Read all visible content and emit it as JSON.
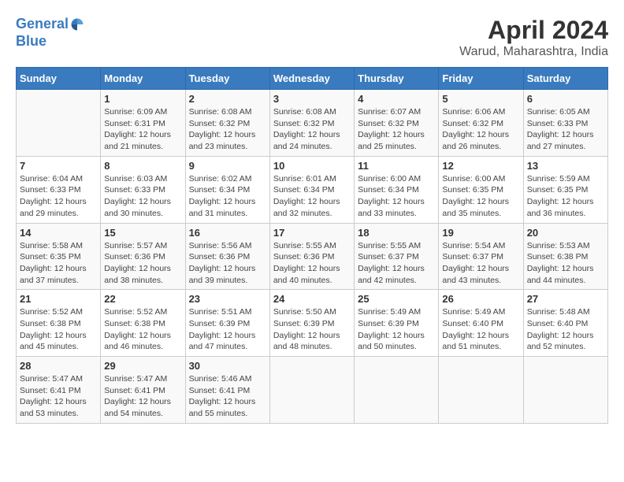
{
  "header": {
    "logo_line1": "General",
    "logo_line2": "Blue",
    "title": "April 2024",
    "subtitle": "Warud, Maharashtra, India"
  },
  "columns": [
    "Sunday",
    "Monday",
    "Tuesday",
    "Wednesday",
    "Thursday",
    "Friday",
    "Saturday"
  ],
  "weeks": [
    [
      {
        "date": "",
        "info": ""
      },
      {
        "date": "1",
        "info": "Sunrise: 6:09 AM\nSunset: 6:31 PM\nDaylight: 12 hours\nand 21 minutes."
      },
      {
        "date": "2",
        "info": "Sunrise: 6:08 AM\nSunset: 6:32 PM\nDaylight: 12 hours\nand 23 minutes."
      },
      {
        "date": "3",
        "info": "Sunrise: 6:08 AM\nSunset: 6:32 PM\nDaylight: 12 hours\nand 24 minutes."
      },
      {
        "date": "4",
        "info": "Sunrise: 6:07 AM\nSunset: 6:32 PM\nDaylight: 12 hours\nand 25 minutes."
      },
      {
        "date": "5",
        "info": "Sunrise: 6:06 AM\nSunset: 6:32 PM\nDaylight: 12 hours\nand 26 minutes."
      },
      {
        "date": "6",
        "info": "Sunrise: 6:05 AM\nSunset: 6:33 PM\nDaylight: 12 hours\nand 27 minutes."
      }
    ],
    [
      {
        "date": "7",
        "info": "Sunrise: 6:04 AM\nSunset: 6:33 PM\nDaylight: 12 hours\nand 29 minutes."
      },
      {
        "date": "8",
        "info": "Sunrise: 6:03 AM\nSunset: 6:33 PM\nDaylight: 12 hours\nand 30 minutes."
      },
      {
        "date": "9",
        "info": "Sunrise: 6:02 AM\nSunset: 6:34 PM\nDaylight: 12 hours\nand 31 minutes."
      },
      {
        "date": "10",
        "info": "Sunrise: 6:01 AM\nSunset: 6:34 PM\nDaylight: 12 hours\nand 32 minutes."
      },
      {
        "date": "11",
        "info": "Sunrise: 6:00 AM\nSunset: 6:34 PM\nDaylight: 12 hours\nand 33 minutes."
      },
      {
        "date": "12",
        "info": "Sunrise: 6:00 AM\nSunset: 6:35 PM\nDaylight: 12 hours\nand 35 minutes."
      },
      {
        "date": "13",
        "info": "Sunrise: 5:59 AM\nSunset: 6:35 PM\nDaylight: 12 hours\nand 36 minutes."
      }
    ],
    [
      {
        "date": "14",
        "info": "Sunrise: 5:58 AM\nSunset: 6:35 PM\nDaylight: 12 hours\nand 37 minutes."
      },
      {
        "date": "15",
        "info": "Sunrise: 5:57 AM\nSunset: 6:36 PM\nDaylight: 12 hours\nand 38 minutes."
      },
      {
        "date": "16",
        "info": "Sunrise: 5:56 AM\nSunset: 6:36 PM\nDaylight: 12 hours\nand 39 minutes."
      },
      {
        "date": "17",
        "info": "Sunrise: 5:55 AM\nSunset: 6:36 PM\nDaylight: 12 hours\nand 40 minutes."
      },
      {
        "date": "18",
        "info": "Sunrise: 5:55 AM\nSunset: 6:37 PM\nDaylight: 12 hours\nand 42 minutes."
      },
      {
        "date": "19",
        "info": "Sunrise: 5:54 AM\nSunset: 6:37 PM\nDaylight: 12 hours\nand 43 minutes."
      },
      {
        "date": "20",
        "info": "Sunrise: 5:53 AM\nSunset: 6:38 PM\nDaylight: 12 hours\nand 44 minutes."
      }
    ],
    [
      {
        "date": "21",
        "info": "Sunrise: 5:52 AM\nSunset: 6:38 PM\nDaylight: 12 hours\nand 45 minutes."
      },
      {
        "date": "22",
        "info": "Sunrise: 5:52 AM\nSunset: 6:38 PM\nDaylight: 12 hours\nand 46 minutes."
      },
      {
        "date": "23",
        "info": "Sunrise: 5:51 AM\nSunset: 6:39 PM\nDaylight: 12 hours\nand 47 minutes."
      },
      {
        "date": "24",
        "info": "Sunrise: 5:50 AM\nSunset: 6:39 PM\nDaylight: 12 hours\nand 48 minutes."
      },
      {
        "date": "25",
        "info": "Sunrise: 5:49 AM\nSunset: 6:39 PM\nDaylight: 12 hours\nand 50 minutes."
      },
      {
        "date": "26",
        "info": "Sunrise: 5:49 AM\nSunset: 6:40 PM\nDaylight: 12 hours\nand 51 minutes."
      },
      {
        "date": "27",
        "info": "Sunrise: 5:48 AM\nSunset: 6:40 PM\nDaylight: 12 hours\nand 52 minutes."
      }
    ],
    [
      {
        "date": "28",
        "info": "Sunrise: 5:47 AM\nSunset: 6:41 PM\nDaylight: 12 hours\nand 53 minutes."
      },
      {
        "date": "29",
        "info": "Sunrise: 5:47 AM\nSunset: 6:41 PM\nDaylight: 12 hours\nand 54 minutes."
      },
      {
        "date": "30",
        "info": "Sunrise: 5:46 AM\nSunset: 6:41 PM\nDaylight: 12 hours\nand 55 minutes."
      },
      {
        "date": "",
        "info": ""
      },
      {
        "date": "",
        "info": ""
      },
      {
        "date": "",
        "info": ""
      },
      {
        "date": "",
        "info": ""
      }
    ]
  ]
}
